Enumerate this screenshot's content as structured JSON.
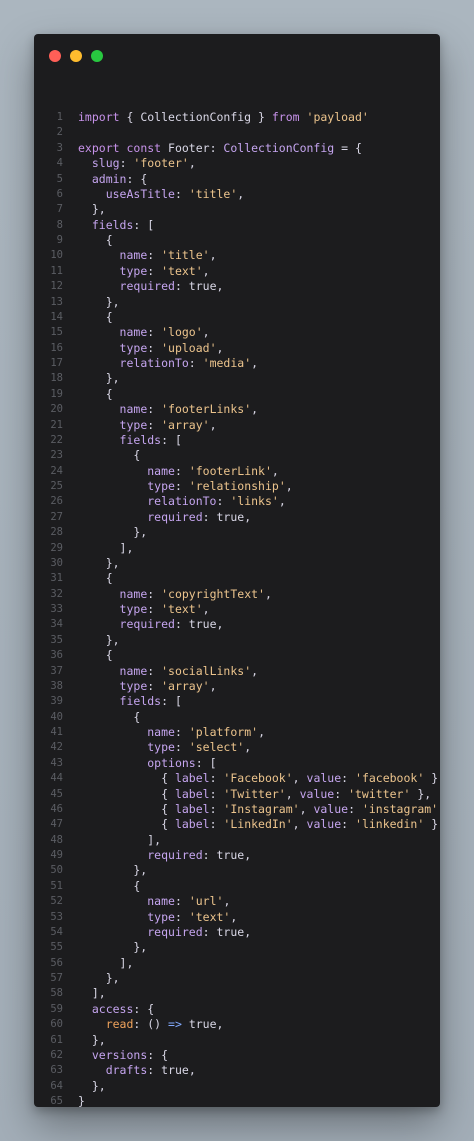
{
  "window": {
    "buttons": [
      "close",
      "minimize",
      "maximize"
    ]
  },
  "code": {
    "language": "typescript",
    "lines": [
      [
        {
          "c": "k",
          "t": "import"
        },
        {
          "c": "t",
          "t": " { CollectionConfig } "
        },
        {
          "c": "k",
          "t": "from"
        },
        {
          "c": "t",
          "t": " "
        },
        {
          "c": "s",
          "t": "'payload'"
        }
      ],
      [],
      [
        {
          "c": "k",
          "t": "export"
        },
        {
          "c": "t",
          "t": " "
        },
        {
          "c": "k",
          "t": "const"
        },
        {
          "c": "t",
          "t": " Footer: "
        },
        {
          "c": "pr",
          "t": "CollectionConfig"
        },
        {
          "c": "t",
          "t": " = {"
        }
      ],
      [
        {
          "c": "t",
          "t": "  "
        },
        {
          "c": "pr",
          "t": "slug"
        },
        {
          "c": "t",
          "t": ": "
        },
        {
          "c": "s",
          "t": "'footer'"
        },
        {
          "c": "t",
          "t": ","
        }
      ],
      [
        {
          "c": "t",
          "t": "  "
        },
        {
          "c": "pr",
          "t": "admin"
        },
        {
          "c": "t",
          "t": ": {"
        }
      ],
      [
        {
          "c": "t",
          "t": "    "
        },
        {
          "c": "pr",
          "t": "useAsTitle"
        },
        {
          "c": "t",
          "t": ": "
        },
        {
          "c": "s",
          "t": "'title'"
        },
        {
          "c": "t",
          "t": ","
        }
      ],
      [
        {
          "c": "t",
          "t": "  },"
        }
      ],
      [
        {
          "c": "t",
          "t": "  "
        },
        {
          "c": "pr",
          "t": "fields"
        },
        {
          "c": "t",
          "t": ": ["
        }
      ],
      [
        {
          "c": "t",
          "t": "    {"
        }
      ],
      [
        {
          "c": "t",
          "t": "      "
        },
        {
          "c": "pr",
          "t": "name"
        },
        {
          "c": "t",
          "t": ": "
        },
        {
          "c": "s",
          "t": "'title'"
        },
        {
          "c": "t",
          "t": ","
        }
      ],
      [
        {
          "c": "t",
          "t": "      "
        },
        {
          "c": "pr",
          "t": "type"
        },
        {
          "c": "t",
          "t": ": "
        },
        {
          "c": "s",
          "t": "'text'"
        },
        {
          "c": "t",
          "t": ","
        }
      ],
      [
        {
          "c": "t",
          "t": "      "
        },
        {
          "c": "pr",
          "t": "required"
        },
        {
          "c": "t",
          "t": ": "
        },
        {
          "c": "b",
          "t": "true"
        },
        {
          "c": "t",
          "t": ","
        }
      ],
      [
        {
          "c": "t",
          "t": "    },"
        }
      ],
      [
        {
          "c": "t",
          "t": "    {"
        }
      ],
      [
        {
          "c": "t",
          "t": "      "
        },
        {
          "c": "pr",
          "t": "name"
        },
        {
          "c": "t",
          "t": ": "
        },
        {
          "c": "s",
          "t": "'logo'"
        },
        {
          "c": "t",
          "t": ","
        }
      ],
      [
        {
          "c": "t",
          "t": "      "
        },
        {
          "c": "pr",
          "t": "type"
        },
        {
          "c": "t",
          "t": ": "
        },
        {
          "c": "s",
          "t": "'upload'"
        },
        {
          "c": "t",
          "t": ","
        }
      ],
      [
        {
          "c": "t",
          "t": "      "
        },
        {
          "c": "pr",
          "t": "relationTo"
        },
        {
          "c": "t",
          "t": ": "
        },
        {
          "c": "s",
          "t": "'media'"
        },
        {
          "c": "t",
          "t": ","
        }
      ],
      [
        {
          "c": "t",
          "t": "    },"
        }
      ],
      [
        {
          "c": "t",
          "t": "    {"
        }
      ],
      [
        {
          "c": "t",
          "t": "      "
        },
        {
          "c": "pr",
          "t": "name"
        },
        {
          "c": "t",
          "t": ": "
        },
        {
          "c": "s",
          "t": "'footerLinks'"
        },
        {
          "c": "t",
          "t": ","
        }
      ],
      [
        {
          "c": "t",
          "t": "      "
        },
        {
          "c": "pr",
          "t": "type"
        },
        {
          "c": "t",
          "t": ": "
        },
        {
          "c": "s",
          "t": "'array'"
        },
        {
          "c": "t",
          "t": ","
        }
      ],
      [
        {
          "c": "t",
          "t": "      "
        },
        {
          "c": "pr",
          "t": "fields"
        },
        {
          "c": "t",
          "t": ": ["
        }
      ],
      [
        {
          "c": "t",
          "t": "        {"
        }
      ],
      [
        {
          "c": "t",
          "t": "          "
        },
        {
          "c": "pr",
          "t": "name"
        },
        {
          "c": "t",
          "t": ": "
        },
        {
          "c": "s",
          "t": "'footerLink'"
        },
        {
          "c": "t",
          "t": ","
        }
      ],
      [
        {
          "c": "t",
          "t": "          "
        },
        {
          "c": "pr",
          "t": "type"
        },
        {
          "c": "t",
          "t": ": "
        },
        {
          "c": "s",
          "t": "'relationship'"
        },
        {
          "c": "t",
          "t": ","
        }
      ],
      [
        {
          "c": "t",
          "t": "          "
        },
        {
          "c": "pr",
          "t": "relationTo"
        },
        {
          "c": "t",
          "t": ": "
        },
        {
          "c": "s",
          "t": "'links'"
        },
        {
          "c": "t",
          "t": ","
        }
      ],
      [
        {
          "c": "t",
          "t": "          "
        },
        {
          "c": "pr",
          "t": "required"
        },
        {
          "c": "t",
          "t": ": "
        },
        {
          "c": "b",
          "t": "true"
        },
        {
          "c": "t",
          "t": ","
        }
      ],
      [
        {
          "c": "t",
          "t": "        },"
        }
      ],
      [
        {
          "c": "t",
          "t": "      ],"
        }
      ],
      [
        {
          "c": "t",
          "t": "    },"
        }
      ],
      [
        {
          "c": "t",
          "t": "    {"
        }
      ],
      [
        {
          "c": "t",
          "t": "      "
        },
        {
          "c": "pr",
          "t": "name"
        },
        {
          "c": "t",
          "t": ": "
        },
        {
          "c": "s",
          "t": "'copyrightText'"
        },
        {
          "c": "t",
          "t": ","
        }
      ],
      [
        {
          "c": "t",
          "t": "      "
        },
        {
          "c": "pr",
          "t": "type"
        },
        {
          "c": "t",
          "t": ": "
        },
        {
          "c": "s",
          "t": "'text'"
        },
        {
          "c": "t",
          "t": ","
        }
      ],
      [
        {
          "c": "t",
          "t": "      "
        },
        {
          "c": "pr",
          "t": "required"
        },
        {
          "c": "t",
          "t": ": "
        },
        {
          "c": "b",
          "t": "true"
        },
        {
          "c": "t",
          "t": ","
        }
      ],
      [
        {
          "c": "t",
          "t": "    },"
        }
      ],
      [
        {
          "c": "t",
          "t": "    {"
        }
      ],
      [
        {
          "c": "t",
          "t": "      "
        },
        {
          "c": "pr",
          "t": "name"
        },
        {
          "c": "t",
          "t": ": "
        },
        {
          "c": "s",
          "t": "'socialLinks'"
        },
        {
          "c": "t",
          "t": ","
        }
      ],
      [
        {
          "c": "t",
          "t": "      "
        },
        {
          "c": "pr",
          "t": "type"
        },
        {
          "c": "t",
          "t": ": "
        },
        {
          "c": "s",
          "t": "'array'"
        },
        {
          "c": "t",
          "t": ","
        }
      ],
      [
        {
          "c": "t",
          "t": "      "
        },
        {
          "c": "pr",
          "t": "fields"
        },
        {
          "c": "t",
          "t": ": ["
        }
      ],
      [
        {
          "c": "t",
          "t": "        {"
        }
      ],
      [
        {
          "c": "t",
          "t": "          "
        },
        {
          "c": "pr",
          "t": "name"
        },
        {
          "c": "t",
          "t": ": "
        },
        {
          "c": "s",
          "t": "'platform'"
        },
        {
          "c": "t",
          "t": ","
        }
      ],
      [
        {
          "c": "t",
          "t": "          "
        },
        {
          "c": "pr",
          "t": "type"
        },
        {
          "c": "t",
          "t": ": "
        },
        {
          "c": "s",
          "t": "'select'"
        },
        {
          "c": "t",
          "t": ","
        }
      ],
      [
        {
          "c": "t",
          "t": "          "
        },
        {
          "c": "pr",
          "t": "options"
        },
        {
          "c": "t",
          "t": ": ["
        }
      ],
      [
        {
          "c": "t",
          "t": "            { "
        },
        {
          "c": "pr",
          "t": "label"
        },
        {
          "c": "t",
          "t": ": "
        },
        {
          "c": "s",
          "t": "'Facebook'"
        },
        {
          "c": "t",
          "t": ", "
        },
        {
          "c": "pr",
          "t": "value"
        },
        {
          "c": "t",
          "t": ": "
        },
        {
          "c": "s",
          "t": "'facebook'"
        },
        {
          "c": "t",
          "t": " },"
        }
      ],
      [
        {
          "c": "t",
          "t": "            { "
        },
        {
          "c": "pr",
          "t": "label"
        },
        {
          "c": "t",
          "t": ": "
        },
        {
          "c": "s",
          "t": "'Twitter'"
        },
        {
          "c": "t",
          "t": ", "
        },
        {
          "c": "pr",
          "t": "value"
        },
        {
          "c": "t",
          "t": ": "
        },
        {
          "c": "s",
          "t": "'twitter'"
        },
        {
          "c": "t",
          "t": " },"
        }
      ],
      [
        {
          "c": "t",
          "t": "            { "
        },
        {
          "c": "pr",
          "t": "label"
        },
        {
          "c": "t",
          "t": ": "
        },
        {
          "c": "s",
          "t": "'Instagram'"
        },
        {
          "c": "t",
          "t": ", "
        },
        {
          "c": "pr",
          "t": "value"
        },
        {
          "c": "t",
          "t": ": "
        },
        {
          "c": "s",
          "t": "'instagram'"
        },
        {
          "c": "t",
          "t": " },"
        }
      ],
      [
        {
          "c": "t",
          "t": "            { "
        },
        {
          "c": "pr",
          "t": "label"
        },
        {
          "c": "t",
          "t": ": "
        },
        {
          "c": "s",
          "t": "'LinkedIn'"
        },
        {
          "c": "t",
          "t": ", "
        },
        {
          "c": "pr",
          "t": "value"
        },
        {
          "c": "t",
          "t": ": "
        },
        {
          "c": "s",
          "t": "'linkedin'"
        },
        {
          "c": "t",
          "t": " },"
        }
      ],
      [
        {
          "c": "t",
          "t": "          ],"
        }
      ],
      [
        {
          "c": "t",
          "t": "          "
        },
        {
          "c": "pr",
          "t": "required"
        },
        {
          "c": "t",
          "t": ": "
        },
        {
          "c": "b",
          "t": "true"
        },
        {
          "c": "t",
          "t": ","
        }
      ],
      [
        {
          "c": "t",
          "t": "        },"
        }
      ],
      [
        {
          "c": "t",
          "t": "        {"
        }
      ],
      [
        {
          "c": "t",
          "t": "          "
        },
        {
          "c": "pr",
          "t": "name"
        },
        {
          "c": "t",
          "t": ": "
        },
        {
          "c": "s",
          "t": "'url'"
        },
        {
          "c": "t",
          "t": ","
        }
      ],
      [
        {
          "c": "t",
          "t": "          "
        },
        {
          "c": "pr",
          "t": "type"
        },
        {
          "c": "t",
          "t": ": "
        },
        {
          "c": "s",
          "t": "'text'"
        },
        {
          "c": "t",
          "t": ","
        }
      ],
      [
        {
          "c": "t",
          "t": "          "
        },
        {
          "c": "pr",
          "t": "required"
        },
        {
          "c": "t",
          "t": ": "
        },
        {
          "c": "b",
          "t": "true"
        },
        {
          "c": "t",
          "t": ","
        }
      ],
      [
        {
          "c": "t",
          "t": "        },"
        }
      ],
      [
        {
          "c": "t",
          "t": "      ],"
        }
      ],
      [
        {
          "c": "t",
          "t": "    },"
        }
      ],
      [
        {
          "c": "t",
          "t": "  ],"
        }
      ],
      [
        {
          "c": "t",
          "t": "  "
        },
        {
          "c": "pr",
          "t": "access"
        },
        {
          "c": "t",
          "t": ": {"
        }
      ],
      [
        {
          "c": "t",
          "t": "    "
        },
        {
          "c": "f",
          "t": "read"
        },
        {
          "c": "t",
          "t": ": () "
        },
        {
          "c": "ar",
          "t": "=>"
        },
        {
          "c": "t",
          "t": " "
        },
        {
          "c": "b",
          "t": "true"
        },
        {
          "c": "t",
          "t": ","
        }
      ],
      [
        {
          "c": "t",
          "t": "  },"
        }
      ],
      [
        {
          "c": "t",
          "t": "  "
        },
        {
          "c": "pr",
          "t": "versions"
        },
        {
          "c": "t",
          "t": ": {"
        }
      ],
      [
        {
          "c": "t",
          "t": "    "
        },
        {
          "c": "pr",
          "t": "drafts"
        },
        {
          "c": "t",
          "t": ": "
        },
        {
          "c": "b",
          "t": "true"
        },
        {
          "c": "t",
          "t": ","
        }
      ],
      [
        {
          "c": "t",
          "t": "  },"
        }
      ],
      [
        {
          "c": "t",
          "t": "}"
        }
      ],
      []
    ]
  },
  "colors": {
    "background": "#a9b4bd",
    "editor": "#1c1c1e",
    "close": "#ff5f57",
    "minimize": "#febc2e",
    "maximize": "#28c840"
  }
}
